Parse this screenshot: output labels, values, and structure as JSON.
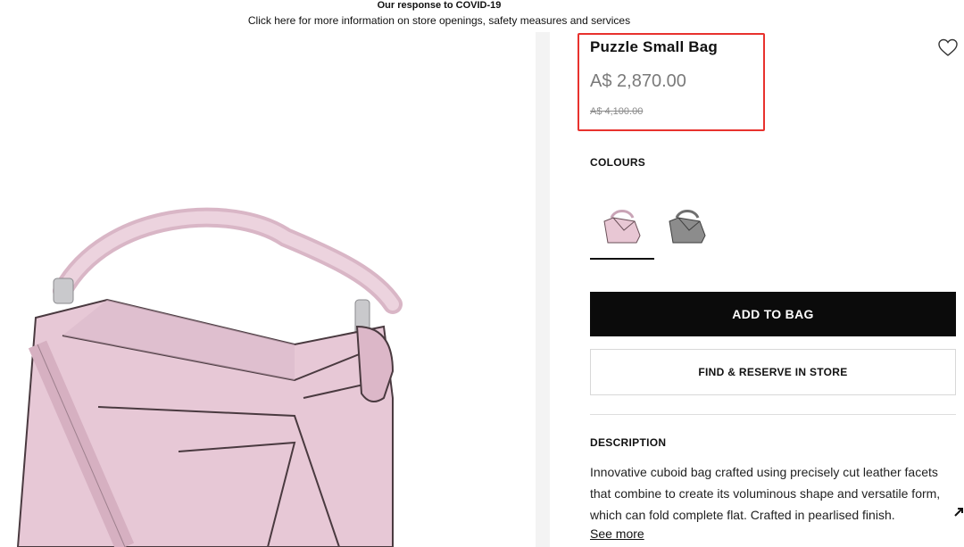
{
  "banner": {
    "title": "Our response to COVID-19",
    "link": "Click here for more information on store openings, safety measures and services"
  },
  "product": {
    "name": "Puzzle Small Bag",
    "price": "A$ 2,870.00",
    "old_price": "A$ 4,100.00"
  },
  "colours": {
    "label": "COLOURS",
    "options": [
      {
        "name": "pink-swatch",
        "color": "#e8c7d4"
      },
      {
        "name": "grey-swatch",
        "color": "#8c8c8c"
      }
    ],
    "selected_index": 0
  },
  "buttons": {
    "add_to_bag": "ADD TO BAG",
    "find_reserve": "FIND & RESERVE IN STORE"
  },
  "description": {
    "label": "DESCRIPTION",
    "text": "Innovative cuboid bag crafted using precisely cut leather facets that combine to create its voluminous shape and versatile form, which can fold complete flat. Crafted in pearlised finish.",
    "see_more": "See more"
  },
  "icons": {
    "wishlist": "heart-icon",
    "corner": "arrow-icon"
  },
  "colors": {
    "highlight_border": "#e8322e",
    "bag_pink": "#e7c8d6",
    "button_dark": "#0b0b0b"
  }
}
